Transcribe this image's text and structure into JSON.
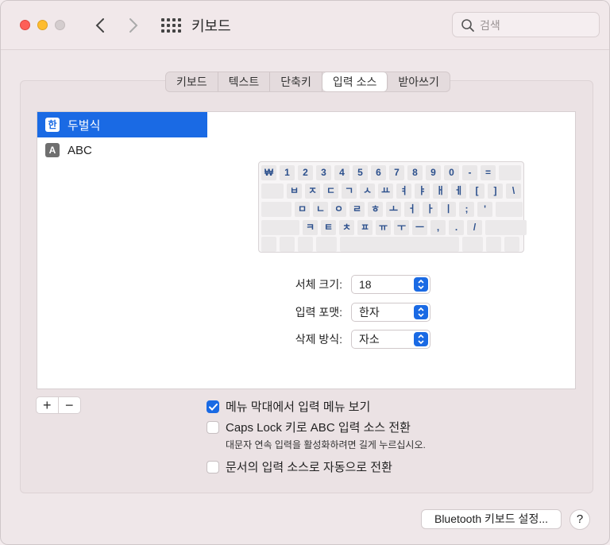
{
  "window": {
    "title": "키보드"
  },
  "search": {
    "placeholder": "검색"
  },
  "tabs": [
    {
      "label": "키보드"
    },
    {
      "label": "텍스트"
    },
    {
      "label": "단축키"
    },
    {
      "label": "입력 소스",
      "active": true
    },
    {
      "label": "받아쓰기"
    }
  ],
  "sources": [
    {
      "icon": "한",
      "label": "두벌식",
      "selected": true
    },
    {
      "icon": "A",
      "label": "ABC",
      "selected": false
    }
  ],
  "keyboard": {
    "row1": [
      "₩",
      "1",
      "2",
      "3",
      "4",
      "5",
      "6",
      "7",
      "8",
      "9",
      "0",
      "-",
      "="
    ],
    "row2": [
      "ㅂ",
      "ㅈ",
      "ㄷ",
      "ㄱ",
      "ㅅ",
      "ㅛ",
      "ㅕ",
      "ㅑ",
      "ㅐ",
      "ㅔ",
      "[",
      "]",
      "\\"
    ],
    "row3": [
      "ㅁ",
      "ㄴ",
      "ㅇ",
      "ㄹ",
      "ㅎ",
      "ㅗ",
      "ㅓ",
      "ㅏ",
      "ㅣ",
      ";",
      "'"
    ],
    "row4": [
      "ㅋ",
      "ㅌ",
      "ㅊ",
      "ㅍ",
      "ㅠ",
      "ㅜ",
      "ㅡ",
      ",",
      ".",
      "/"
    ]
  },
  "settings": {
    "font_size": {
      "label": "서체 크기:",
      "value": "18"
    },
    "input_format": {
      "label": "입력 포맷:",
      "value": "한자"
    },
    "delete_mode": {
      "label": "삭제 방식:",
      "value": "자소"
    }
  },
  "list_controls": {
    "add": "+",
    "remove": "−"
  },
  "options": {
    "show_menu": {
      "label": "메뉴 막대에서 입력 메뉴 보기",
      "checked": true
    },
    "caps_lock": {
      "label": "Caps Lock 키로 ABC 입력 소스 전환",
      "checked": false,
      "note": "대문자 연속 입력을 활성화하려면 길게 누르십시오."
    },
    "auto_switch": {
      "label": "문서의 입력 소스로 자동으로 전환",
      "checked": false
    }
  },
  "footer": {
    "bluetooth_label": "Bluetooth 키보드 설정...",
    "help_label": "?"
  }
}
